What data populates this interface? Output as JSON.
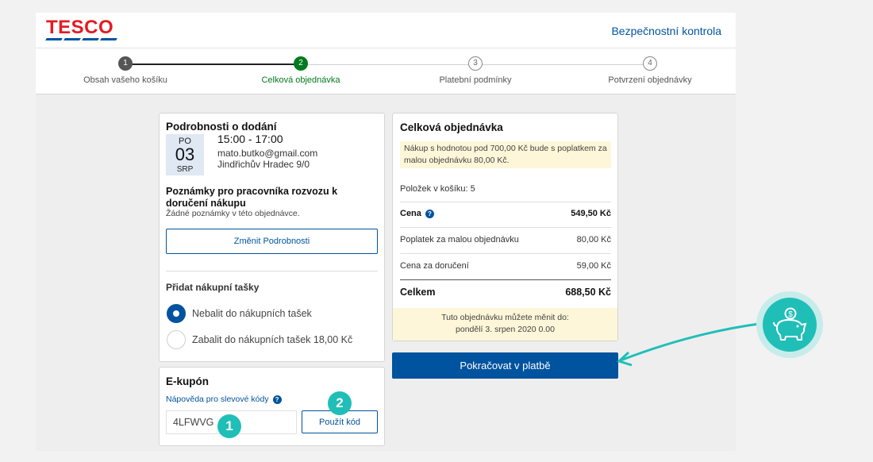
{
  "header": {
    "logo_text": "TESCO",
    "title": "Bezpečnostní kontrola"
  },
  "steps": [
    {
      "number": "1",
      "label": "Obsah vašeho košíku",
      "state": "done"
    },
    {
      "number": "2",
      "label": "Celková objednávka",
      "state": "active"
    },
    {
      "number": "3",
      "label": "Platební podmínky",
      "state": "todo"
    },
    {
      "number": "4",
      "label": "Potvrzení objednávky",
      "state": "todo"
    }
  ],
  "delivery": {
    "title": "Podrobnosti o dodání",
    "date": {
      "dow": "PO",
      "day": "03",
      "month": "SRP"
    },
    "time": "15:00 - 17:00",
    "email": "mato.butko@gmail.com",
    "address": "Jindřichův Hradec 9/0",
    "notes_title": "Poznámky pro pracovníka rozvozu k doručení nákupu",
    "notes_text": "Žádné poznámky v této objednávce.",
    "change_button": "Změnit Podrobnosti",
    "bags_title": "Přidat nákupní tašky",
    "bag_options": [
      {
        "label": "Nebalit do nákupních tašek",
        "checked": true
      },
      {
        "label": "Zabalit do nákupních tašek 18,00 Kč",
        "checked": false
      }
    ]
  },
  "coupon": {
    "title": "E-kupón",
    "help_link": "Nápověda pro slevové kódy",
    "input_value": "4LFWVG",
    "apply_button": "Použít kód",
    "badges": [
      "1",
      "2"
    ]
  },
  "summary": {
    "title": "Celková objednávka",
    "notice": "Nákup s hodnotou pod 700,00 Kč bude s poplatkem za malou objednávku 80,00 Kč.",
    "items_label": "Položek v košíku:",
    "items_count": "5",
    "rows": [
      {
        "label": "Cena",
        "value": "549,50 Kč"
      },
      {
        "label": "Poplatek za malou objednávku",
        "value": "80,00 Kč"
      },
      {
        "label": "Cena za doručení",
        "value": "59,00 Kč"
      },
      {
        "label": "Celkem",
        "value": "688,50 Kč"
      }
    ],
    "edit_until_line1": "Tuto objednávku můžete měnit do:",
    "edit_until_line2": "pondělí 3. srpen 2020 0.00"
  },
  "continue_button": "Pokračovat v platbě",
  "colors": {
    "brand_blue": "#00539f",
    "brand_red": "#e31b23",
    "accent_teal": "#1fbfb8",
    "active_green": "#007a1e"
  }
}
